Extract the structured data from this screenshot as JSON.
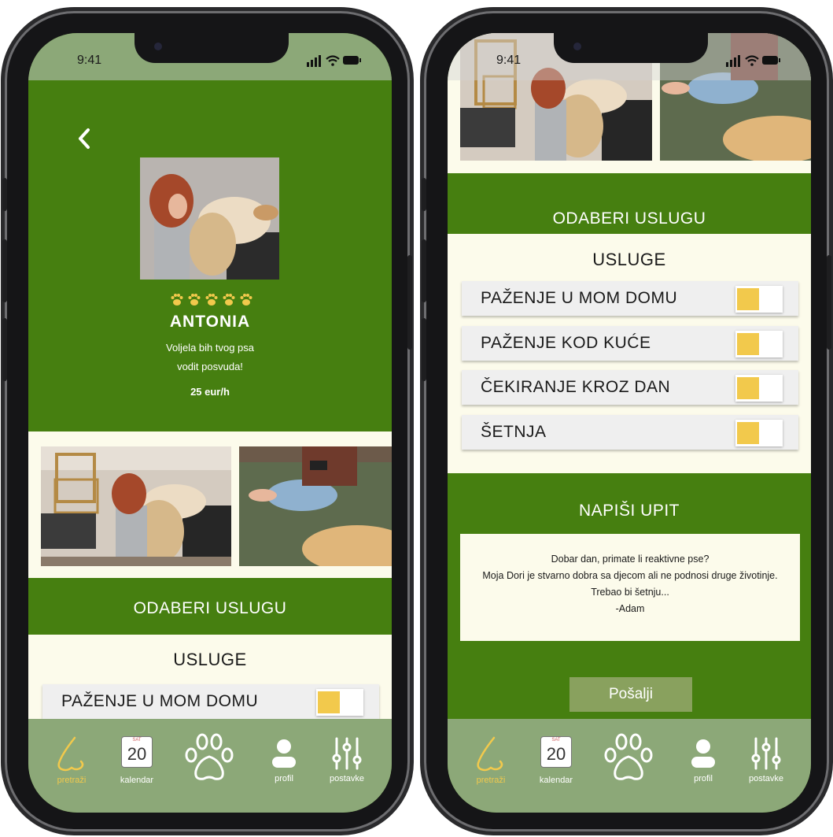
{
  "status_time": "9:41",
  "left": {
    "profile_name": "ANTONIA",
    "bio_line1": "Voljela bih tvog psa",
    "bio_line2": "vodit posvuda!",
    "price": "25 eur/h",
    "rating_paws": 5,
    "section_title": "ODABERI USLUGU",
    "services_heading": "USLUGE",
    "first_service": "PAŽENJE U MOM DOMU"
  },
  "right": {
    "section_title": "ODABERI USLUGU",
    "services_heading": "USLUGE",
    "services": [
      "PAŽENJE U MOM DOMU",
      "PAŽENJE KOD KUĆE",
      "ČEKIRANJE KROZ DAN",
      "ŠETNJA"
    ],
    "inquiry_title": "NAPIŠI UPIT",
    "message_line1": "Dobar dan, primate li reaktivne pse?",
    "message_line2": "Moja Dori je stvarno dobra sa djecom ali ne podnosi druge životinje.",
    "message_line3": "Trebao bi šetnju...",
    "message_line4": "-Adam",
    "send_label": "Pošalji"
  },
  "nav": {
    "search": "pretraži",
    "calendar_day": "20",
    "calendar_month": "SAT",
    "calendar": "kalendar",
    "profile": "profil",
    "settings": "postavke"
  },
  "colors": {
    "green": "#467f10",
    "light_green": "#8ca878",
    "cream": "#fcfbeb",
    "yellow": "#f2c94c",
    "button": "#89a15e"
  },
  "icons": [
    "back-arrow-icon",
    "paw-icon",
    "signal-icon",
    "wifi-icon",
    "battery-icon",
    "nose-icon",
    "calendar-icon",
    "person-icon",
    "sliders-icon"
  ]
}
